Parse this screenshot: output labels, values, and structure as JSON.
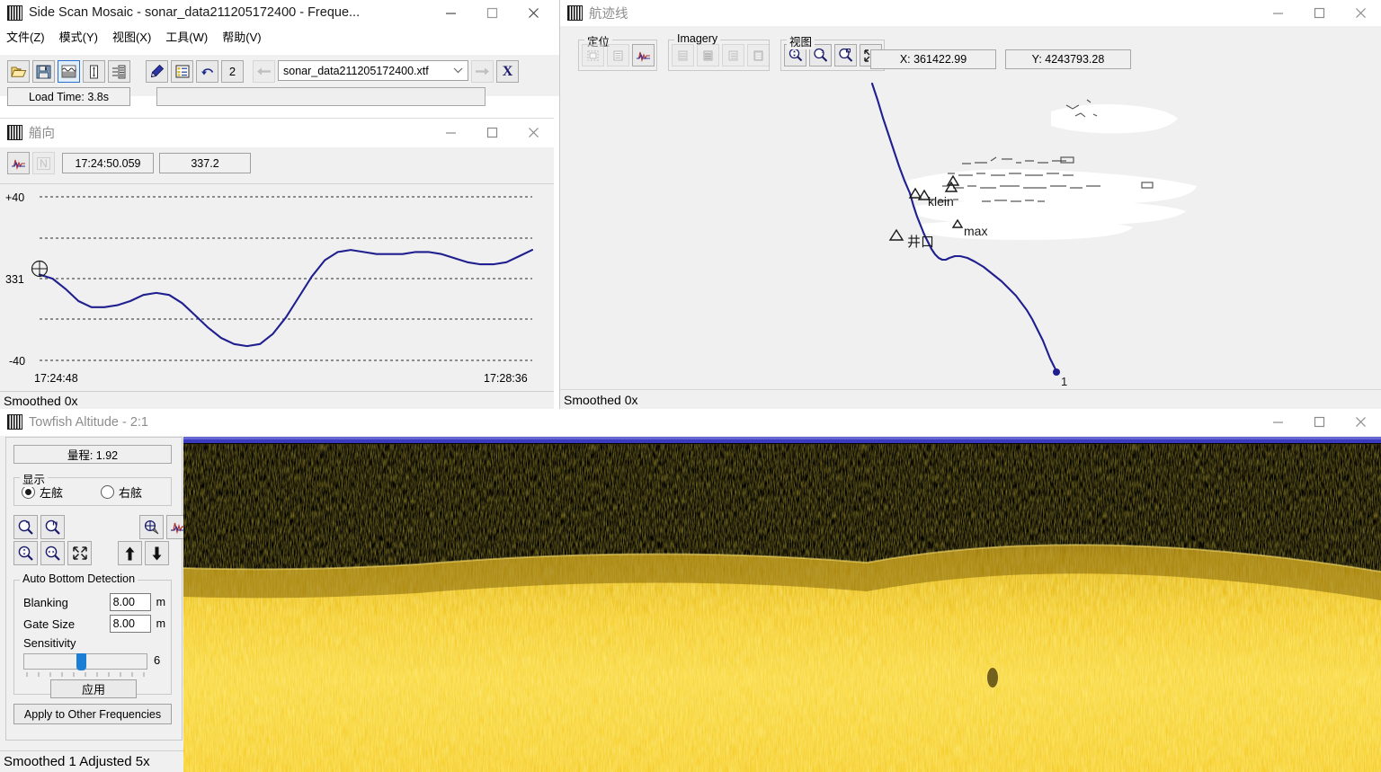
{
  "mosaic_window": {
    "title": "Side Scan Mosaic - sonar_data211205172400 - Freque...",
    "app_icon": "barcode-icon",
    "menu": [
      {
        "label": "文件(Z)"
      },
      {
        "label": "模式(Y)"
      },
      {
        "label": "视图(X)"
      },
      {
        "label": "工具(W)"
      },
      {
        "label": "帮助(V)"
      }
    ],
    "toolbar": {
      "open_label": "open-folder-icon",
      "save_label": "floppy-save-icon",
      "waterfall_label": "waterfall-view-icon",
      "vertical_label": "vertical-strip-icon",
      "layers_label": "layered-strip-icon",
      "pen_label": "pen-icon",
      "list_label": "list-icon",
      "undo_label": "undo-icon",
      "count_label": "2",
      "prev_label": "arrow-left-icon",
      "next_label": "arrow-right-icon",
      "close_x_label": "X"
    },
    "file_select": {
      "value": "sonar_data211205172400.xtf"
    },
    "load_time": "Load Time: 3.8s",
    "progress_value": ""
  },
  "track_window": {
    "title": "航迹线",
    "groups": {
      "locate": "定位",
      "imagery": "Imagery",
      "view": "视图"
    },
    "coords": {
      "x": "X: 361422.99",
      "y": "Y: 4243793.28"
    },
    "status": "Smoothed 0x",
    "map": {
      "markers": [
        {
          "label": "klein",
          "x": 410,
          "y": 135
        },
        {
          "label": "max",
          "x": 452,
          "y": 169
        },
        {
          "label": "井口",
          "x": 385,
          "y": 178
        }
      ],
      "endpoint_label": "1",
      "line_color": "#1f1f8f"
    }
  },
  "heading_window": {
    "title": "艏向",
    "toolbar": {
      "waveform_label": "waveform-icon",
      "north_label": "N"
    },
    "time_value": "17:24:50.059",
    "heading_value": "337.2",
    "status": "Smoothed 0x",
    "chart_data": {
      "type": "line",
      "title": "艏向",
      "ylabel": "",
      "xlabel": "",
      "y_ticks": [
        "+40",
        "331",
        "-40"
      ],
      "ylim": [
        -40,
        40
      ],
      "center_value": 331,
      "x_ticks": [
        "17:24:48",
        "17:28:36"
      ],
      "grid": true,
      "series": [
        {
          "name": "heading",
          "color": "#1f1f8f",
          "values": [
            2,
            0,
            -5,
            -11,
            -14,
            -14,
            -13,
            -11,
            -8,
            -7,
            -8,
            -12,
            -18,
            -24,
            -29,
            -32,
            -33,
            -32,
            -27,
            -19,
            -9,
            1,
            9,
            13,
            14,
            13,
            12,
            12,
            12,
            13,
            13,
            12,
            10,
            8,
            7,
            7,
            8,
            11,
            14
          ]
        }
      ]
    }
  },
  "towfish_window": {
    "title": "Towfish Altitude - 2:1",
    "range_label": "量程: 1.92",
    "display_group": "显示",
    "channels": [
      {
        "label": "左舷",
        "selected": true
      },
      {
        "label": "右舷",
        "selected": false
      }
    ],
    "tool_icons": [
      "zoom-horizontal-icon",
      "zoom-window-icon",
      "zoom-vertical-icon",
      "zoom-width-icon",
      "fit-screen-icon",
      "crosshair-icon",
      "waveform-icon",
      "arrow-up-icon",
      "arrow-down-icon"
    ],
    "auto_bottom": {
      "caption": "Auto Bottom Detection",
      "blanking_label": "Blanking",
      "blanking_value": "8.00",
      "blanking_unit": "m",
      "gate_label": "Gate Size",
      "gate_value": "8.00",
      "gate_unit": "m",
      "sensitivity_label": "Sensitivity",
      "sensitivity_value": "6",
      "apply_label": "应用"
    },
    "apply_other_label": "Apply to Other Frequencies",
    "status": "Smoothed 1 Adjusted 5x"
  }
}
